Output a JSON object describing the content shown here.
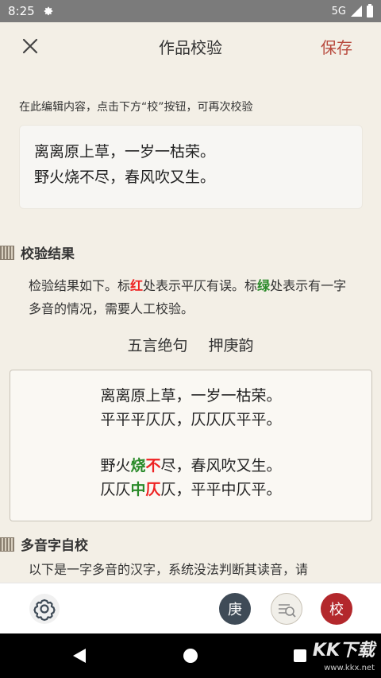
{
  "status_bar": {
    "time": "8:25",
    "network": "5G"
  },
  "header": {
    "title": "作品校验",
    "save_label": "保存"
  },
  "editor": {
    "hint": "在此编辑内容，点击下方“校”按钮，可再次校验",
    "lines": [
      "离离原上草，一岁一枯荣。",
      "野火烧不尽，春风吹又生。"
    ]
  },
  "result": {
    "section_title": "校验结果",
    "desc_1": "检验结果如下。标",
    "desc_red": "红",
    "desc_2": "处表示平仄有误。标",
    "desc_green": "绿",
    "desc_3": "处表示有一字多音的情况，需要人工校验。",
    "form": "五言绝句",
    "rhyme": "押庚韵",
    "couplet1_text": "离离原上草，一岁一枯荣。",
    "couplet1_tone": "平平平仄仄，仄仄仄平平。",
    "couplet2_text": {
      "a": "野火",
      "b": "烧",
      "c": "不",
      "d": "尽，春风吹又生。"
    },
    "couplet2_tone": {
      "a": "仄仄",
      "b": "中",
      "c": "仄",
      "d": "仄，平平中仄平。"
    }
  },
  "polyphone": {
    "section_title": "多音字自校",
    "desc": "以下是一字多音的汉字，系统没法判断其读音，请"
  },
  "toolbar": {
    "geng_label": "庚",
    "jiao_label": "校"
  },
  "watermark": {
    "logo": "KK下载",
    "url": "www.kkx.net"
  },
  "colors": {
    "accent": "#b84a3e",
    "error": "#e22222",
    "polyphone": "#2a8a2a",
    "geng_button": "#3f4b57",
    "jiao_button": "#b3282c"
  }
}
